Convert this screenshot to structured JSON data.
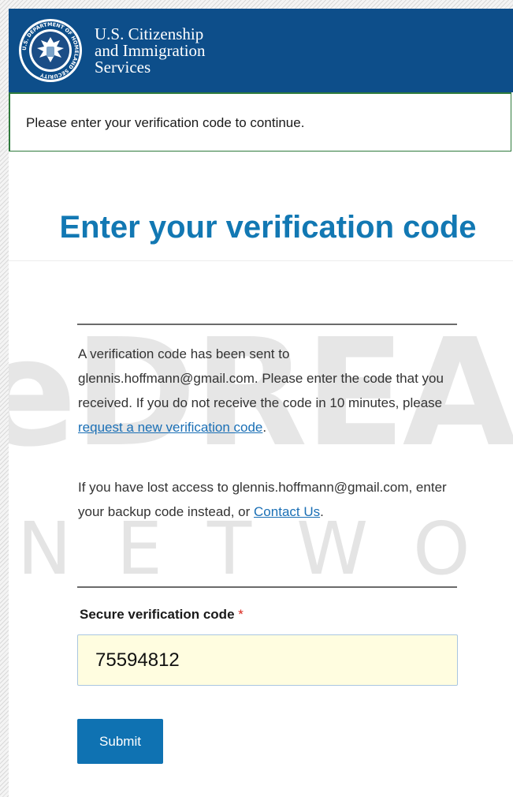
{
  "header": {
    "agency_line1": "U.S. Citizenship",
    "agency_line2": "and Immigration",
    "agency_line3": "Services",
    "seal_icon": "dhs-seal-icon",
    "seal_text": "U.S. DEPARTMENT OF HOMELAND SECURITY",
    "background_color": "#0d4e8a"
  },
  "alert": {
    "message": "Please enter your verification code to continue.",
    "border_color": "#2e7a3c"
  },
  "main": {
    "title": "Enter your verification code",
    "paragraph1_text": "A verification code has been sent to glennis.hoffmann@gmail.com. Please enter the code that you received. If you do not receive the code in 10 minutes, please ",
    "paragraph1_link": "request a new verification code",
    "paragraph1_end": ".",
    "paragraph2_text": "If you have lost access to glennis.hoffmann@gmail.com, enter your backup code instead, or ",
    "paragraph2_link": "Contact Us",
    "paragraph2_end": ".",
    "field_label": "Secure verification code",
    "required_marker": "*",
    "code_value": "75594812",
    "submit_label": "Submit",
    "accent_color": "#1278b3"
  },
  "watermark": {
    "line1": "eDREAM",
    "line2": "NETWORK"
  }
}
